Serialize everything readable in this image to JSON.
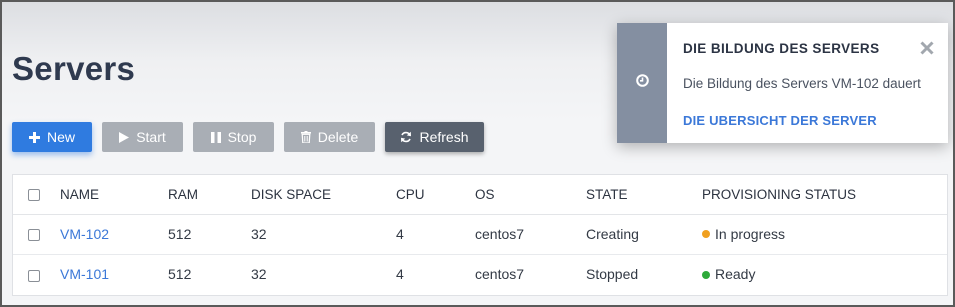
{
  "page": {
    "title": "Servers"
  },
  "toolbar": {
    "new_label": "New",
    "start_label": "Start",
    "stop_label": "Stop",
    "delete_label": "Delete",
    "refresh_label": "Refresh"
  },
  "table": {
    "columns": [
      "NAME",
      "RAM",
      "DISK SPACE",
      "CPU",
      "OS",
      "STATE",
      "PROVISIONING STATUS"
    ],
    "rows": [
      {
        "name": "VM-102",
        "ram": "512",
        "disk": "32",
        "cpu": "4",
        "os": "centos7",
        "state": "Creating",
        "status": "In progress",
        "status_color": "#f0a020"
      },
      {
        "name": "VM-101",
        "ram": "512",
        "disk": "32",
        "cpu": "4",
        "os": "centos7",
        "state": "Stopped",
        "status": "Ready",
        "status_color": "#2eaa3a"
      }
    ]
  },
  "notification": {
    "title": "DIE BILDUNG DES SERVERS",
    "message": "Die Bildung des Servers VM-102 dauert",
    "link_label": "DIE UBERSICHT DER SERVER",
    "icon": "clock-icon",
    "close_icon": "close-icon"
  },
  "colors": {
    "primary": "#2f7be0",
    "disabled": "#a9aeb5",
    "refresh": "#58616e",
    "link": "#3b78d8",
    "title": "#2f3a4f"
  }
}
